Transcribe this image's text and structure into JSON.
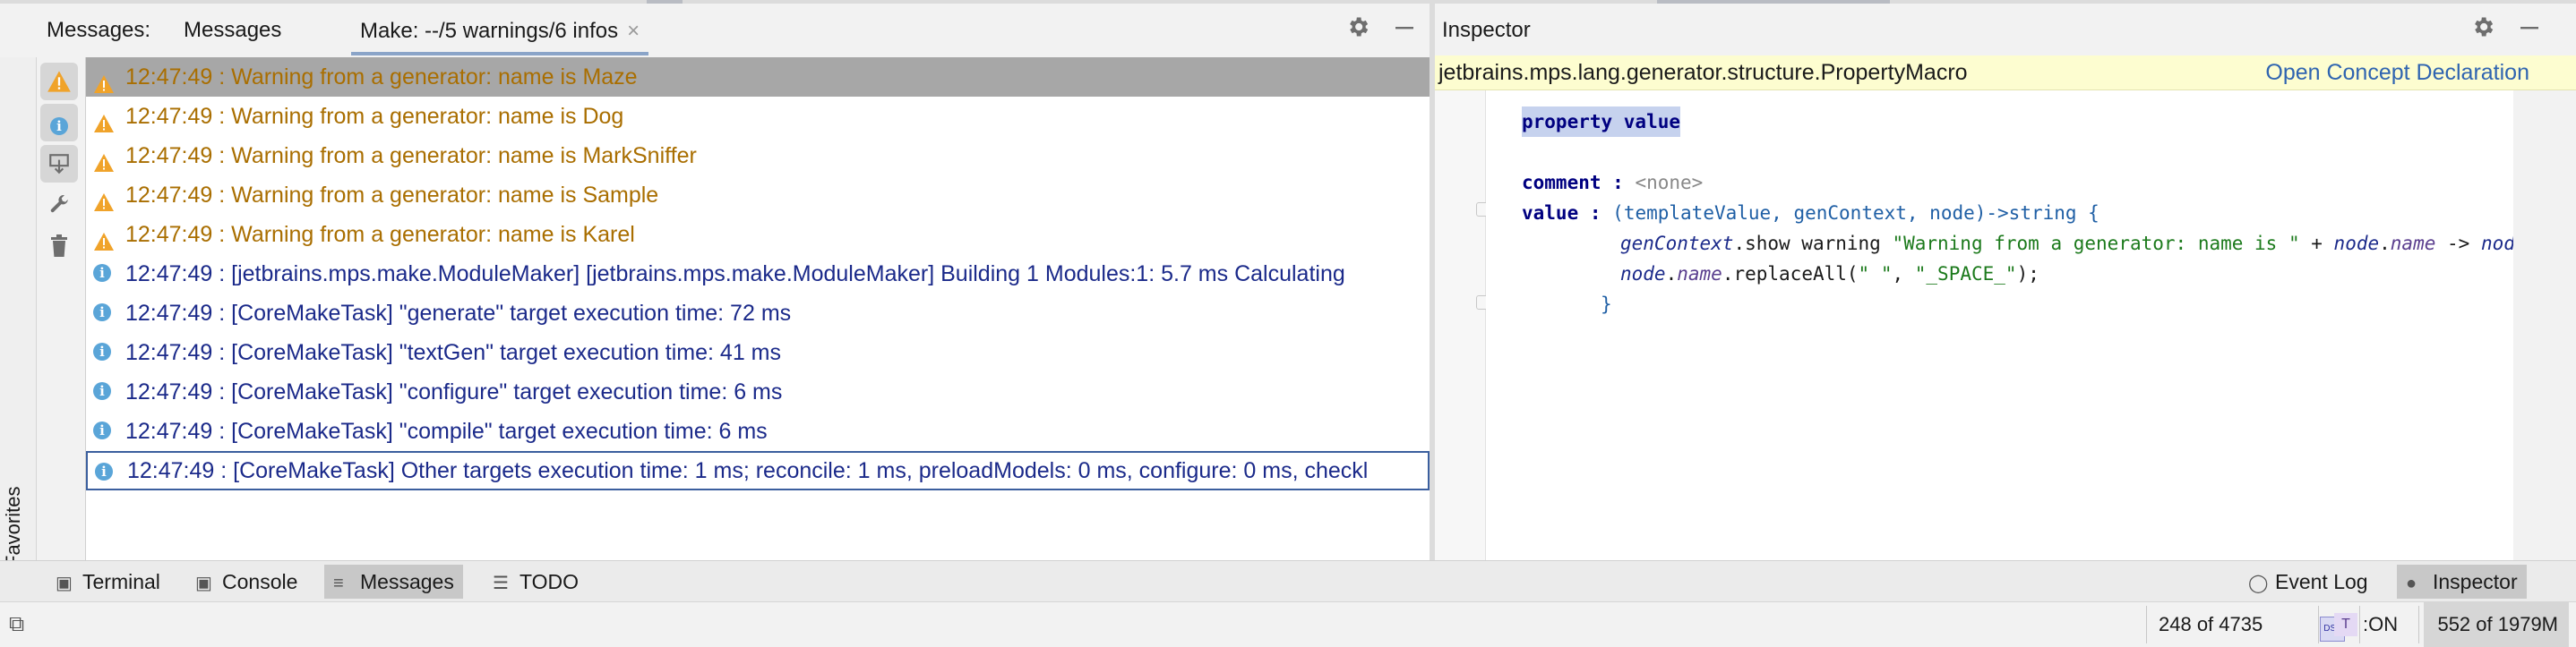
{
  "messages_window": {
    "title": "Messages:",
    "tab_messages": "Messages",
    "tab_make": "Make: --/5 warnings/6 infos",
    "tab_make_close": "×",
    "settings_icon": "gear-icon",
    "minimize_icon": "minimize-icon",
    "toolbar": [
      {
        "name": "warning-filter-icon",
        "on": true
      },
      {
        "name": "info-filter-icon",
        "on": true
      },
      {
        "name": "autoscroll-icon",
        "on": true
      },
      {
        "name": "wrench-icon",
        "on": false
      },
      {
        "name": "trash-icon",
        "on": false
      }
    ],
    "rows": [
      {
        "level": "warning",
        "text": "12:47:49 : Warning from a generator: name is Maze"
      },
      {
        "level": "warning",
        "text": "12:47:49 : Warning from a generator: name is Dog"
      },
      {
        "level": "warning",
        "text": "12:47:49 : Warning from a generator: name is MarkSniffer"
      },
      {
        "level": "warning",
        "text": "12:47:49 : Warning from a generator: name is Sample"
      },
      {
        "level": "warning",
        "text": "12:47:49 : Warning from a generator: name is Karel"
      },
      {
        "level": "info",
        "text": "12:47:49 : [jetbrains.mps.make.ModuleMaker] [jetbrains.mps.make.ModuleMaker] Building 1 Modules:1: 5.7 ms     Calculating"
      },
      {
        "level": "info",
        "text": "12:47:49 : [CoreMakeTask] \"generate\" target execution time: 72 ms"
      },
      {
        "level": "info",
        "text": "12:47:49 : [CoreMakeTask] \"textGen\" target execution time: 41 ms"
      },
      {
        "level": "info",
        "text": "12:47:49 : [CoreMakeTask] \"configure\" target execution time: 6 ms"
      },
      {
        "level": "info",
        "text": "12:47:49 : [CoreMakeTask] \"compile\" target execution time: 6 ms"
      },
      {
        "level": "info",
        "text": "12:47:49 : [CoreMakeTask] Other targets execution time: 1 ms; reconcile: 1 ms, preloadModels: 0 ms, configure: 0 ms, checkl"
      }
    ],
    "selected_row": 0,
    "focused_row": 10
  },
  "favorites": {
    "label": "Favorites"
  },
  "inspector": {
    "title": "Inspector",
    "concept": "jetbrains.mps.lang.generator.structure.PropertyMacro",
    "open_concept": "Open Concept Declaration",
    "code": {
      "heading": "property value",
      "comment_key": "comment :",
      "comment_value": "<none>",
      "value_key": "value :",
      "signature": "(templateValue, genContext, node)->string {",
      "line1_obj": "genContext",
      "line1_method": ".show",
      "line1_warning": " warning ",
      "line1_string": "\"Warning from a generator: name is \"",
      "line1_plus": " + ",
      "line1_node": "node",
      "line1_dot": ".",
      "line1_field": "name",
      "line1_arrow": " -> ",
      "line1_node2": "node",
      "line1_end": ";",
      "line2_node": "node",
      "line2_dot": ".",
      "line2_field": "name",
      "line2_call": ".replaceAll(",
      "line2_arg1": "\" \"",
      "line2_comma": ", ",
      "line2_arg2": "\"_SPACE_\"",
      "line2_end": ");",
      "close_brace": "}"
    }
  },
  "bottom_tabs": {
    "terminal": "Terminal",
    "console": "Console",
    "messages": "Messages",
    "todo": "TODO",
    "event_log": "Event Log",
    "inspector": "Inspector"
  },
  "status_bar": {
    "position": "248 of 4735",
    "dsl_badge": "DSL",
    "typesystem_label": ":ON",
    "typesystem_badge": "T",
    "memory": "552 of 1979M"
  },
  "colors": {
    "warning_text": "#a96e00",
    "info_text": "#1b2a8a",
    "link": "#2f64b0",
    "concept_bar": "#fdfdd0",
    "selection": "#a7a7a7"
  }
}
